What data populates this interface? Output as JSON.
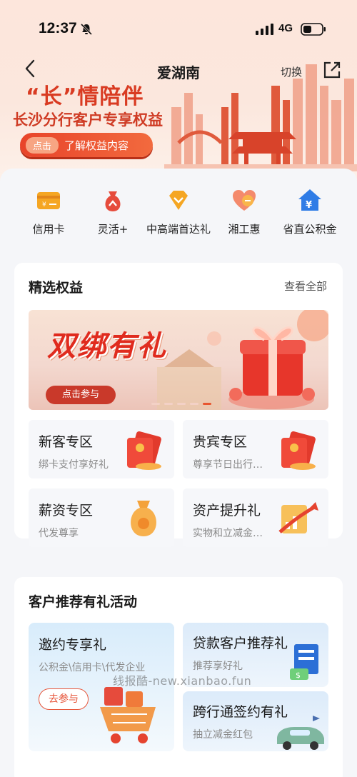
{
  "status_bar": {
    "time": "12:37",
    "network": "4G"
  },
  "nav": {
    "title": "爱湖南",
    "switch_label": "切换"
  },
  "banner": {
    "title": "“长”情陪伴",
    "subtitle": "长沙分行客户专享权益",
    "button_tag": "点击",
    "button_text": "了解权益内容"
  },
  "quick_actions": [
    {
      "label": "信用卡",
      "icon": "credit-card-icon"
    },
    {
      "label": "灵活+",
      "icon": "money-bag-icon"
    },
    {
      "label": "中高端首达礼",
      "icon": "diamond-icon"
    },
    {
      "label": "湘工惠",
      "icon": "heart-icon"
    },
    {
      "label": "省直公积金",
      "icon": "house-yuan-icon"
    }
  ],
  "benefits": {
    "title": "精选权益",
    "view_all": "查看全部",
    "promo": {
      "title": "双绑有礼",
      "button": "点击参与"
    },
    "tiles": [
      {
        "title": "新客专区",
        "subtitle": "绑卡支付享好礼",
        "icon": "red-envelope-icon"
      },
      {
        "title": "贵宾专区",
        "subtitle": "尊享节日出行…",
        "icon": "red-envelope-icon"
      },
      {
        "title": "薪资专区",
        "subtitle": "代发尊享",
        "icon": "money-bag-icon"
      },
      {
        "title": "资产提升礼",
        "subtitle": "实物和立减金…",
        "icon": "growth-chart-icon"
      }
    ]
  },
  "referral": {
    "title": "客户推荐有礼活动",
    "cards": [
      {
        "title": "邀约专享礼",
        "subtitle": "公积金\\信用卡\\代发企业",
        "button": "去参与"
      },
      {
        "title": "贷款客户推荐礼",
        "subtitle": "推荐享好礼"
      },
      {
        "title": "跨行通签约有礼",
        "subtitle": "抽立减金红包"
      }
    ]
  },
  "watermark": "线报酷-new.xianbao.fun",
  "colors": {
    "brand_red": "#e02b1e",
    "accent_orange": "#f26a3e",
    "page_bg": "#f5f6f9"
  }
}
